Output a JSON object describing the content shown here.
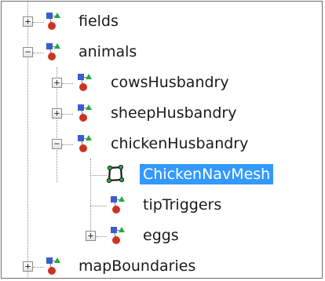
{
  "tree": {
    "nodes": [
      {
        "label": "fields",
        "expander": "+",
        "icon": "scene-node-icon"
      },
      {
        "label": "animals",
        "expander": "−",
        "icon": "scene-node-icon"
      },
      {
        "label": "cowsHusbandry",
        "expander": "+",
        "icon": "scene-node-icon"
      },
      {
        "label": "sheepHusbandry",
        "expander": "+",
        "icon": "scene-node-icon"
      },
      {
        "label": "chickenHusbandry",
        "expander": "−",
        "icon": "scene-node-icon"
      },
      {
        "label": "ChickenNavMesh",
        "expander": "",
        "icon": "navmesh-icon",
        "selected": true
      },
      {
        "label": "tipTriggers",
        "expander": "",
        "icon": "scene-node-icon"
      },
      {
        "label": "eggs",
        "expander": "+",
        "icon": "scene-node-icon"
      },
      {
        "label": "mapBoundaries",
        "expander": "+",
        "icon": "scene-node-icon"
      }
    ]
  },
  "colors": {
    "selection": "#3399ff",
    "icon_blue": "#3a5ccc",
    "icon_red": "#cc3322",
    "icon_green": "#22aa44"
  }
}
